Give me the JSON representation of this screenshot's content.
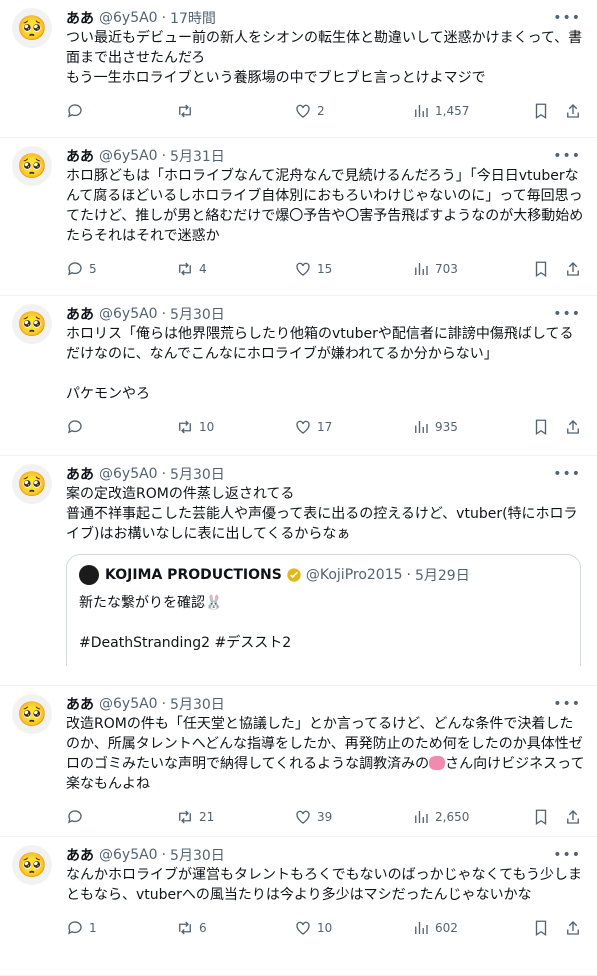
{
  "tweets": [
    {
      "name": "ああ",
      "handle": "@6y5A0",
      "time": "17時間",
      "text": "つい最近もデビュー前の新人をシオンの転生体と勘違いして迷惑かけまくって、書面まで出させたんだろ\nもう一生ホロライブという養豚場の中でブヒブヒ言っとけよマジで",
      "replies": "",
      "retweets": "",
      "likes": "2",
      "views": "1,457"
    },
    {
      "name": "ああ",
      "handle": "@6y5A0",
      "time": "5月31日",
      "text": "ホロ豚どもは「ホロライブなんて泥舟なんで見続けるんだろう」「今日日vtuberなんて腐るほどいるしホロライブ自体別におもろいわけじゃないのに」って毎回思ってたけど、推しが男と絡むだけで爆〇予告や〇害予告飛ばすようなのが大移動始めたらそれはそれで迷惑か",
      "replies": "5",
      "retweets": "4",
      "likes": "15",
      "views": "703"
    },
    {
      "name": "ああ",
      "handle": "@6y5A0",
      "time": "5月30日",
      "text": "ホロリス「俺らは他界隈荒らしたり他箱のvtuberや配信者に誹謗中傷飛ばしてるだけなのに、なんでこんなにホロライブが嫌われてるか分からない」\n\nパケモンやろ",
      "replies": "",
      "retweets": "10",
      "likes": "17",
      "views": "935"
    },
    {
      "name": "ああ",
      "handle": "@6y5A0",
      "time": "5月30日",
      "text": "案の定改造ROMの件蒸し返されてる\n普通不祥事起こした芸能人や声優って表に出るの控えるけど、vtuber(特にホロライブ)はお構いなしに表に出してくるからなぁ",
      "quote": {
        "name": "KOJIMA PRODUCTIONS",
        "handle": "@KojiPro2015",
        "time": "5月29日",
        "text": "新たな繋がりを確認🐰\n\n#DeathStranding2 #デススト2"
      }
    },
    {
      "name": "ああ",
      "handle": "@6y5A0",
      "time": "5月30日",
      "text_a": "改造ROMの件も「任天堂と協議した」とか言ってるけど、どんな条件で決着したのか、所属タレントへどんな指導をしたか、再発防止のため何をしたのか具体性ゼロのゴミみたいな声明で納得してくれるような調教済みの",
      "text_b": "さん向けビジネスって楽なもんよね",
      "replies": "",
      "retweets": "21",
      "likes": "39",
      "views": "2,650"
    },
    {
      "name": "ああ",
      "handle": "@6y5A0",
      "time": "5月30日",
      "text": "なんかホロライブが運営もタレントもろくでもないのばっかじゃなくてもう少しまともなら、vtuberへの風当たりは今より多少はマシだったんじゃないかな",
      "replies": "1",
      "retweets": "6",
      "likes": "10",
      "views": "602"
    }
  ],
  "icons": {
    "avatar": "pleading-face-emoji",
    "reply": "reply-icon",
    "retweet": "retweet-icon",
    "like": "heart-icon",
    "views": "views-icon",
    "bookmark": "bookmark-icon",
    "share": "share-icon",
    "more": "more-icon"
  },
  "colors": {
    "muted": "#536471",
    "border": "#eff3f4",
    "verified": "#e2b719"
  }
}
